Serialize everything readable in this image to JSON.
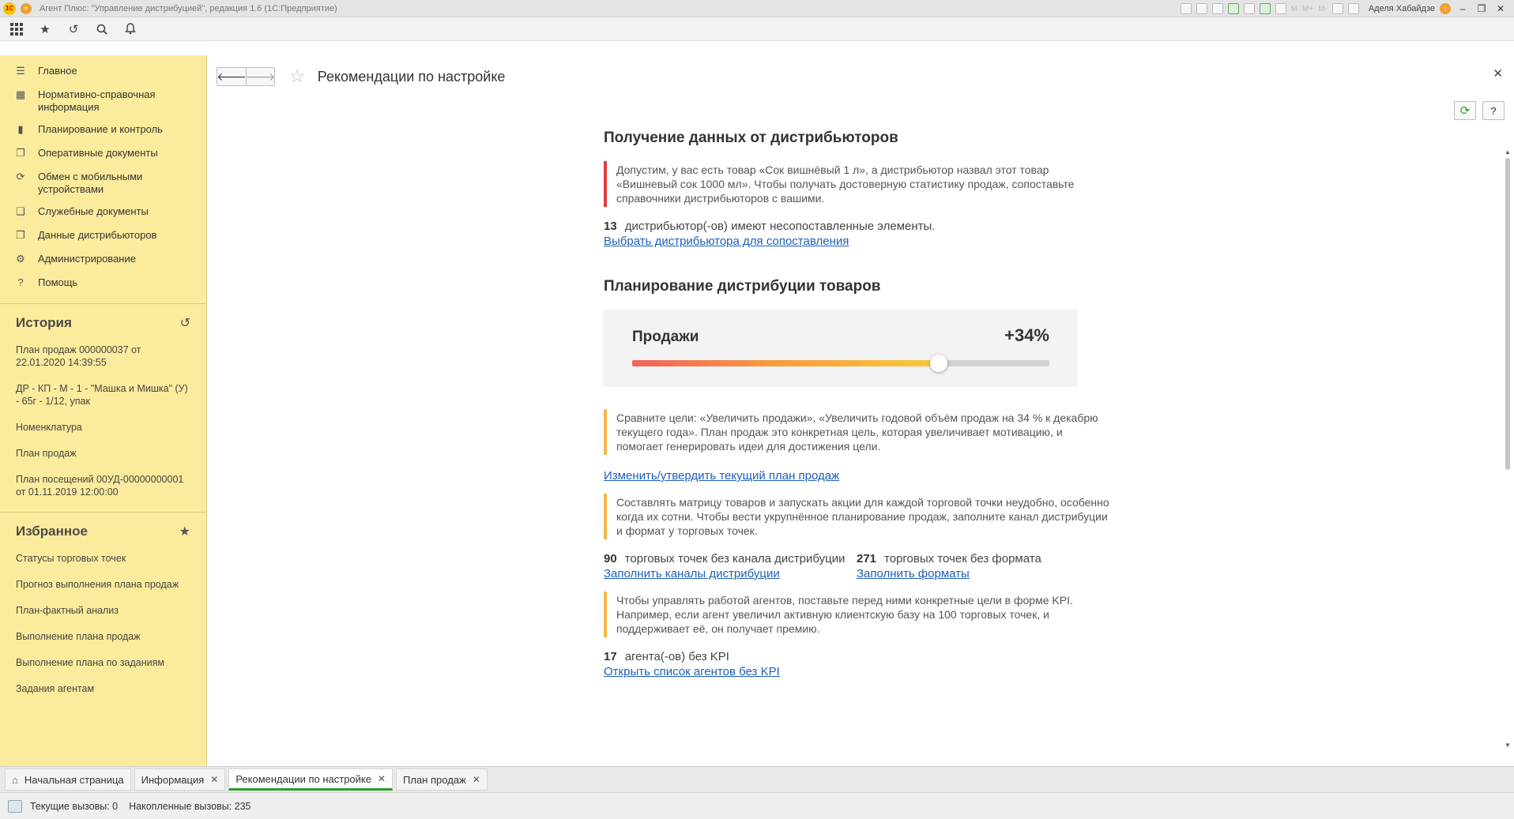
{
  "window": {
    "title": "Агент Плюс: \"Управление дистрибуцией\", редакция 1.6  (1С:Предприятие)",
    "logo_text": "1С",
    "user": "Аделя Хабайдзе",
    "toolbar_m_labels": [
      "M",
      "M+",
      "M-"
    ]
  },
  "sidebar": {
    "items": [
      {
        "label": "Главное",
        "icon": "menu-icon"
      },
      {
        "label": "Нормативно-справочная информация",
        "icon": "grid-icon"
      },
      {
        "label": "Планирование и контроль",
        "icon": "bar-chart-icon"
      },
      {
        "label": "Оперативные документы",
        "icon": "documents-icon"
      },
      {
        "label": "Обмен с мобильными устройствами",
        "icon": "sync-icon"
      },
      {
        "label": "Служебные документы",
        "icon": "service-docs-icon"
      },
      {
        "label": "Данные дистрибьюторов",
        "icon": "distributor-data-icon"
      },
      {
        "label": "Администрирование",
        "icon": "gear-icon"
      },
      {
        "label": "Помощь",
        "icon": "help-icon"
      }
    ],
    "history": {
      "title": "История",
      "items": [
        "План продаж 000000037 от 22.01.2020 14:39:55",
        "ДР - КП - М - 1 - \"Машка и Мишка\" (У) - 65г - 1/12, упак",
        "Номенклатура",
        "План продаж",
        "План посещений 00УД-00000000001 от 01.11.2019 12:00:00"
      ]
    },
    "favorites": {
      "title": "Избранное",
      "items": [
        "Статусы торговых точек",
        "Прогноз выполнения плана продаж",
        "План-фактный анализ",
        "Выполнение плана продаж",
        "Выполнение плана по заданиям",
        "Задания агентам"
      ]
    }
  },
  "form": {
    "title": "Рекомендации по настройке",
    "help_label": "?"
  },
  "content": {
    "section1": {
      "heading": "Получение данных от дистрибьюторов",
      "note": "Допустим, у вас есть товар «Сок вишнёвый 1 л», а дистрибьютор назвал этот товар «Вишневый сок 1000 мл». Чтобы получать достоверную статистику продаж, сопоставьте справочники дистрибьюторов с вашими.",
      "count": "13",
      "count_text": "дистрибьютор(-ов) имеют несопоставленные элементы.",
      "link": "Выбрать дистрибьютора для сопоставления"
    },
    "section2": {
      "heading": "Планирование дистрибуции товаров",
      "promo_label": "Продажи",
      "promo_value": "+34%",
      "slider_fraction": 0.734,
      "note1": "Сравните цели: «Увеличить продажи», «Увеличить годовой объём продаж на 34 % к декабрю текущего года». План продаж это конкретная цель, которая увеличивает мотивацию, и помогает генерировать идеи для достижения цели.",
      "link1": "Изменить/утвердить текущий план продаж",
      "note2": "Составлять матрицу товаров и запускать акции для каждой торговой точки неудобно, особенно когда их сотни. Чтобы вести укрупнённое планирование продаж, заполните канал дистрибуции и формат у торговых точек.",
      "channel_count": "90",
      "channel_text": "торговых точек без канала дистрибуции",
      "channel_link": "Заполнить каналы дистрибуции",
      "format_count": "271",
      "format_text": "торговых точек без формата",
      "format_link": "Заполнить форматы",
      "note3": "Чтобы управлять работой агентов, поставьте перед ними конкретные цели в форме KPI. Например, если агент увеличил активную клиентскую базу на 100 торговых точек, и поддерживает её, он получает премию.",
      "agent_count": "17",
      "agent_text": "агента(-ов) без KPI",
      "agent_link": "Открыть список агентов без KPI"
    }
  },
  "tabs": [
    {
      "label": "Начальная страница",
      "active": false
    },
    {
      "label": "Информация",
      "active": false
    },
    {
      "label": "Рекомендации по настройке",
      "active": true
    },
    {
      "label": "План продаж",
      "active": false
    }
  ],
  "status": {
    "current_calls": "Текущие вызовы: 0",
    "accumulated_calls": "Накопленные вызовы: 235"
  },
  "colors": {
    "sidebar_bg": "#fbec9d",
    "note_red": "#e23b3b",
    "note_orange": "#f5b54a",
    "link": "#1d5fb8",
    "active_tab": "#2c9c2c"
  }
}
